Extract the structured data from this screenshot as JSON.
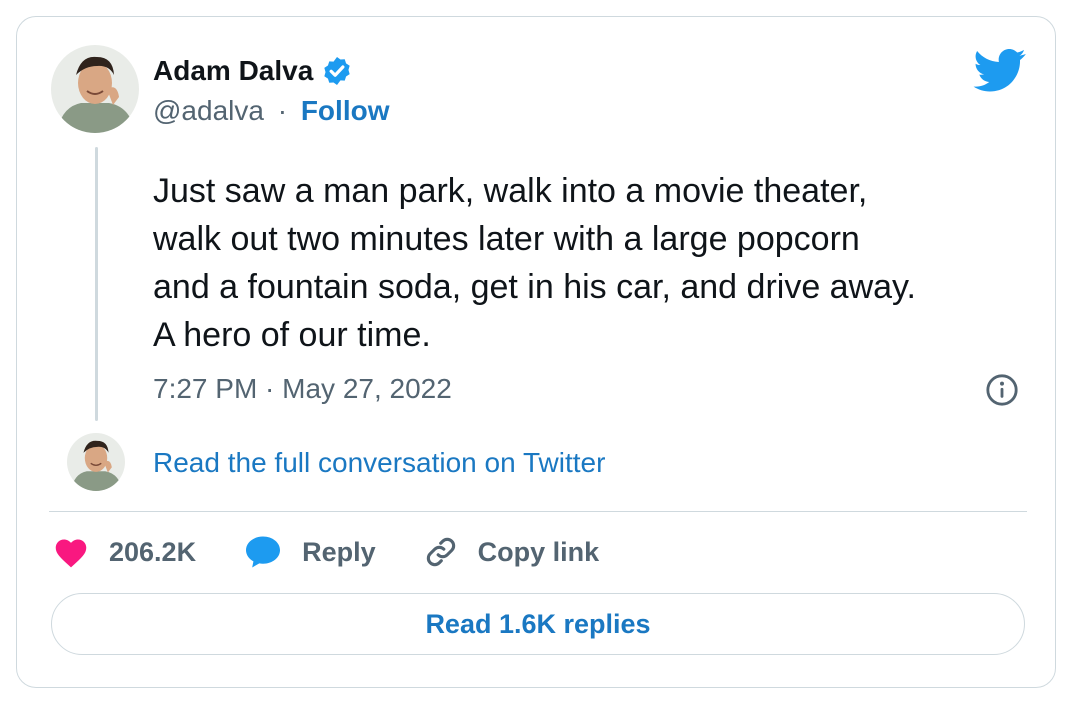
{
  "author": {
    "name": "Adam Dalva",
    "handle": "@adalva",
    "separator": "·",
    "follow_label": "Follow"
  },
  "tweet": {
    "text": "Just saw a man park, walk into a movie theater,\nwalk out two minutes later with a large popcorn\nand a fountain soda, get in his car, and drive away.\nA hero of our time.",
    "timestamp": "7:27 PM · May 27, 2022"
  },
  "conversation_link": "Read the full conversation on Twitter",
  "actions": {
    "likes": "206.2K",
    "reply_label": "Reply",
    "copy_link_label": "Copy link"
  },
  "read_replies_label": "Read 1.6K replies",
  "colors": {
    "accent": "#1d9bf0",
    "link": "#1a78c2",
    "heart": "#f91880",
    "text": "#0f1419",
    "muted": "#536471",
    "border": "#cfd9de"
  },
  "icons": [
    "verified-badge-icon",
    "twitter-bird-icon",
    "info-icon",
    "heart-icon",
    "reply-bubble-icon",
    "link-icon"
  ]
}
